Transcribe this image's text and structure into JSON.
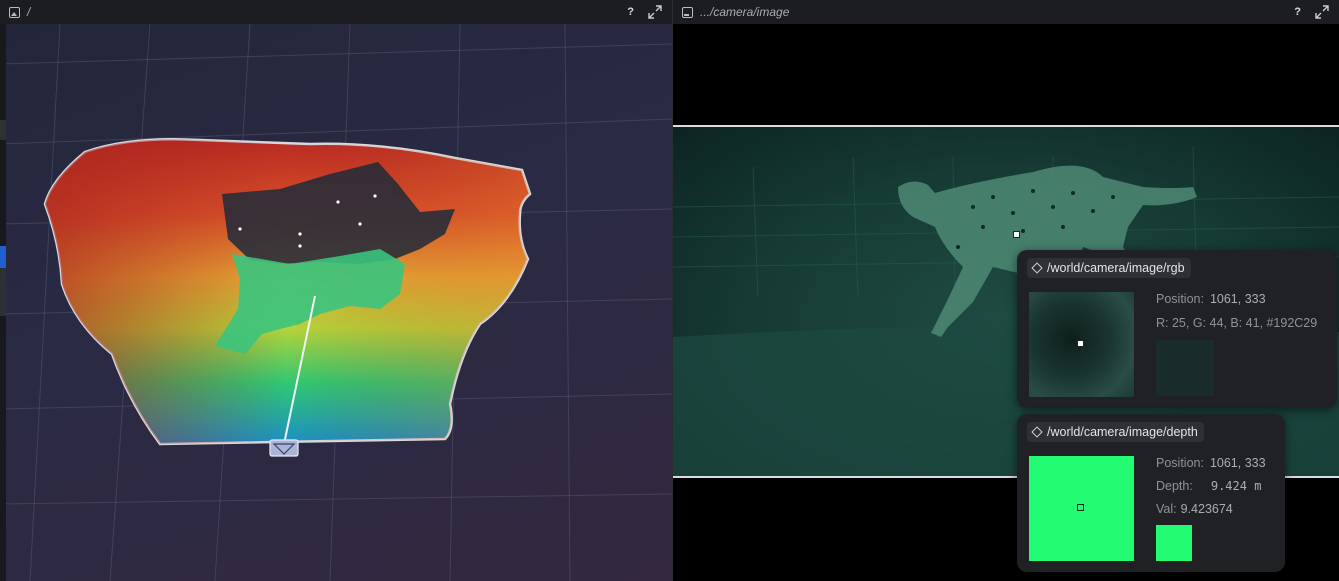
{
  "left_panel": {
    "title": "/",
    "help_label": "?"
  },
  "right_panel": {
    "title": ".../camera/image",
    "help_label": "?"
  },
  "rgb_tooltip": {
    "entity_path": "/world/camera/image/rgb",
    "position_label": "Position:",
    "position_value": "1061, 333",
    "pixel_value": "R: 25, G: 44, B: 41, #192C29",
    "swatch_color": "#192C29"
  },
  "depth_tooltip": {
    "entity_path": "/world/camera/image/depth",
    "position_label": "Position:",
    "position_value": "1061, 333",
    "depth_label": "Depth:",
    "depth_value": "9.424 m",
    "val_label": "Val:",
    "val_value": "9.423674",
    "swatch_color": "#22FB72"
  },
  "colors": {
    "accent": "#1f5fd0",
    "panel_bg": "#1b1d21",
    "card_bg": "#1f2125"
  },
  "icons": {
    "left_title_icon": "image-space-icon",
    "right_title_icon": "camera-space-icon",
    "expand_icon": "expand-icon",
    "entity_icon": "entity-diamond-icon"
  }
}
